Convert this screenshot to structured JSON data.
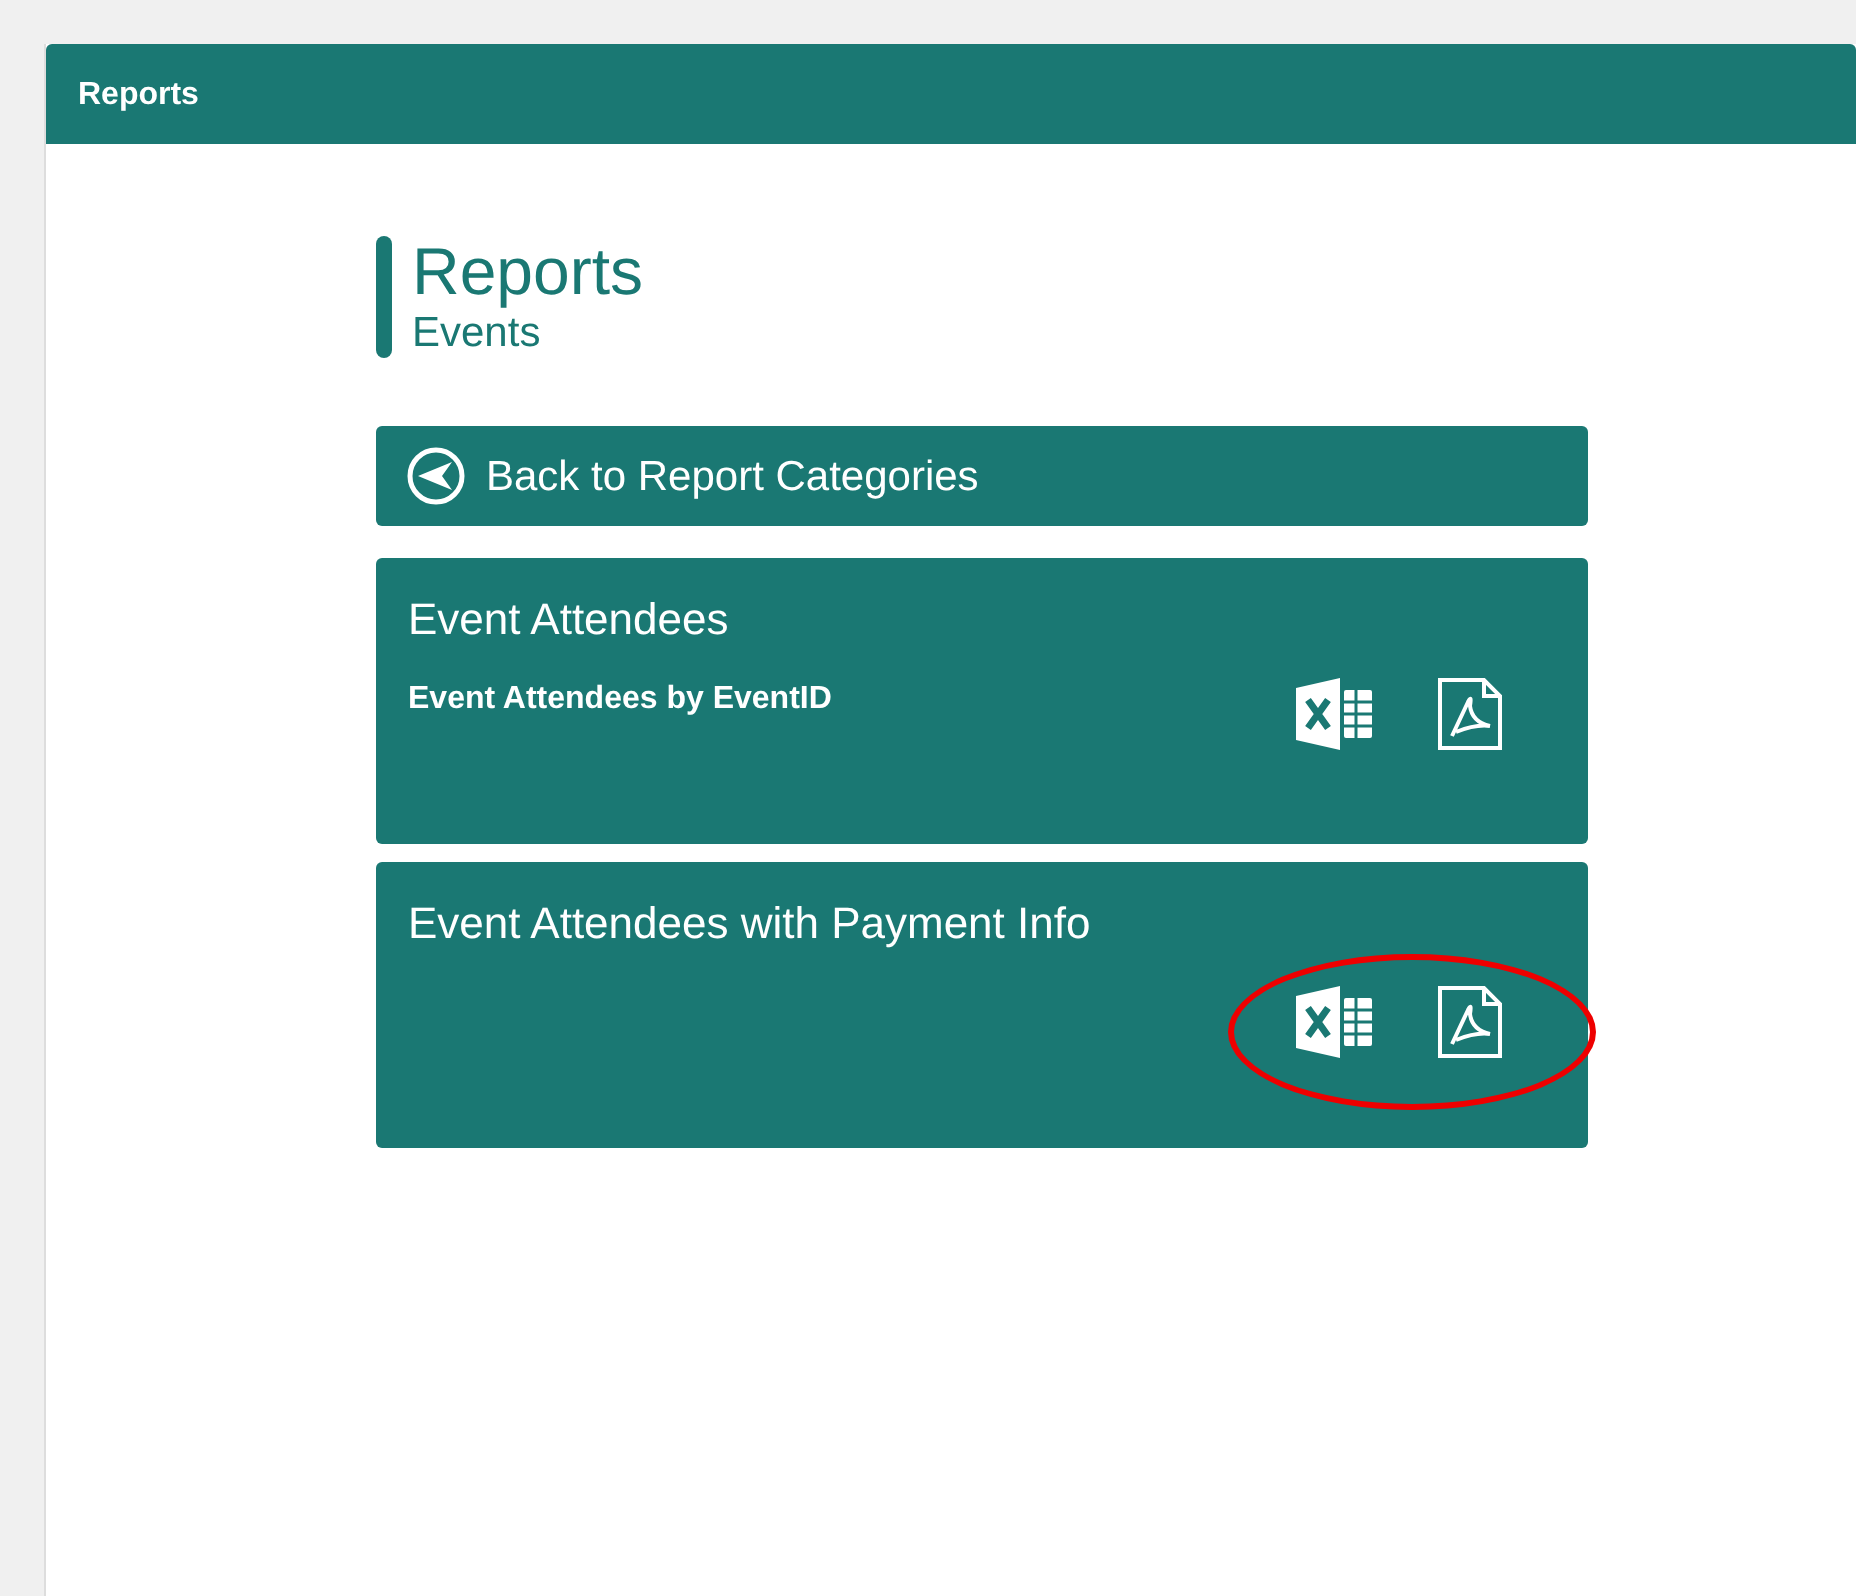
{
  "panel": {
    "title": "Reports"
  },
  "heading": {
    "title": "Reports",
    "subtitle": "Events"
  },
  "back_button": {
    "label": "Back to Report Categories"
  },
  "reports": [
    {
      "title": "Event Attendees",
      "description": "Event Attendees by EventID",
      "highlighted": false
    },
    {
      "title": "Event Attendees with Payment Info",
      "highlighted": true
    }
  ]
}
